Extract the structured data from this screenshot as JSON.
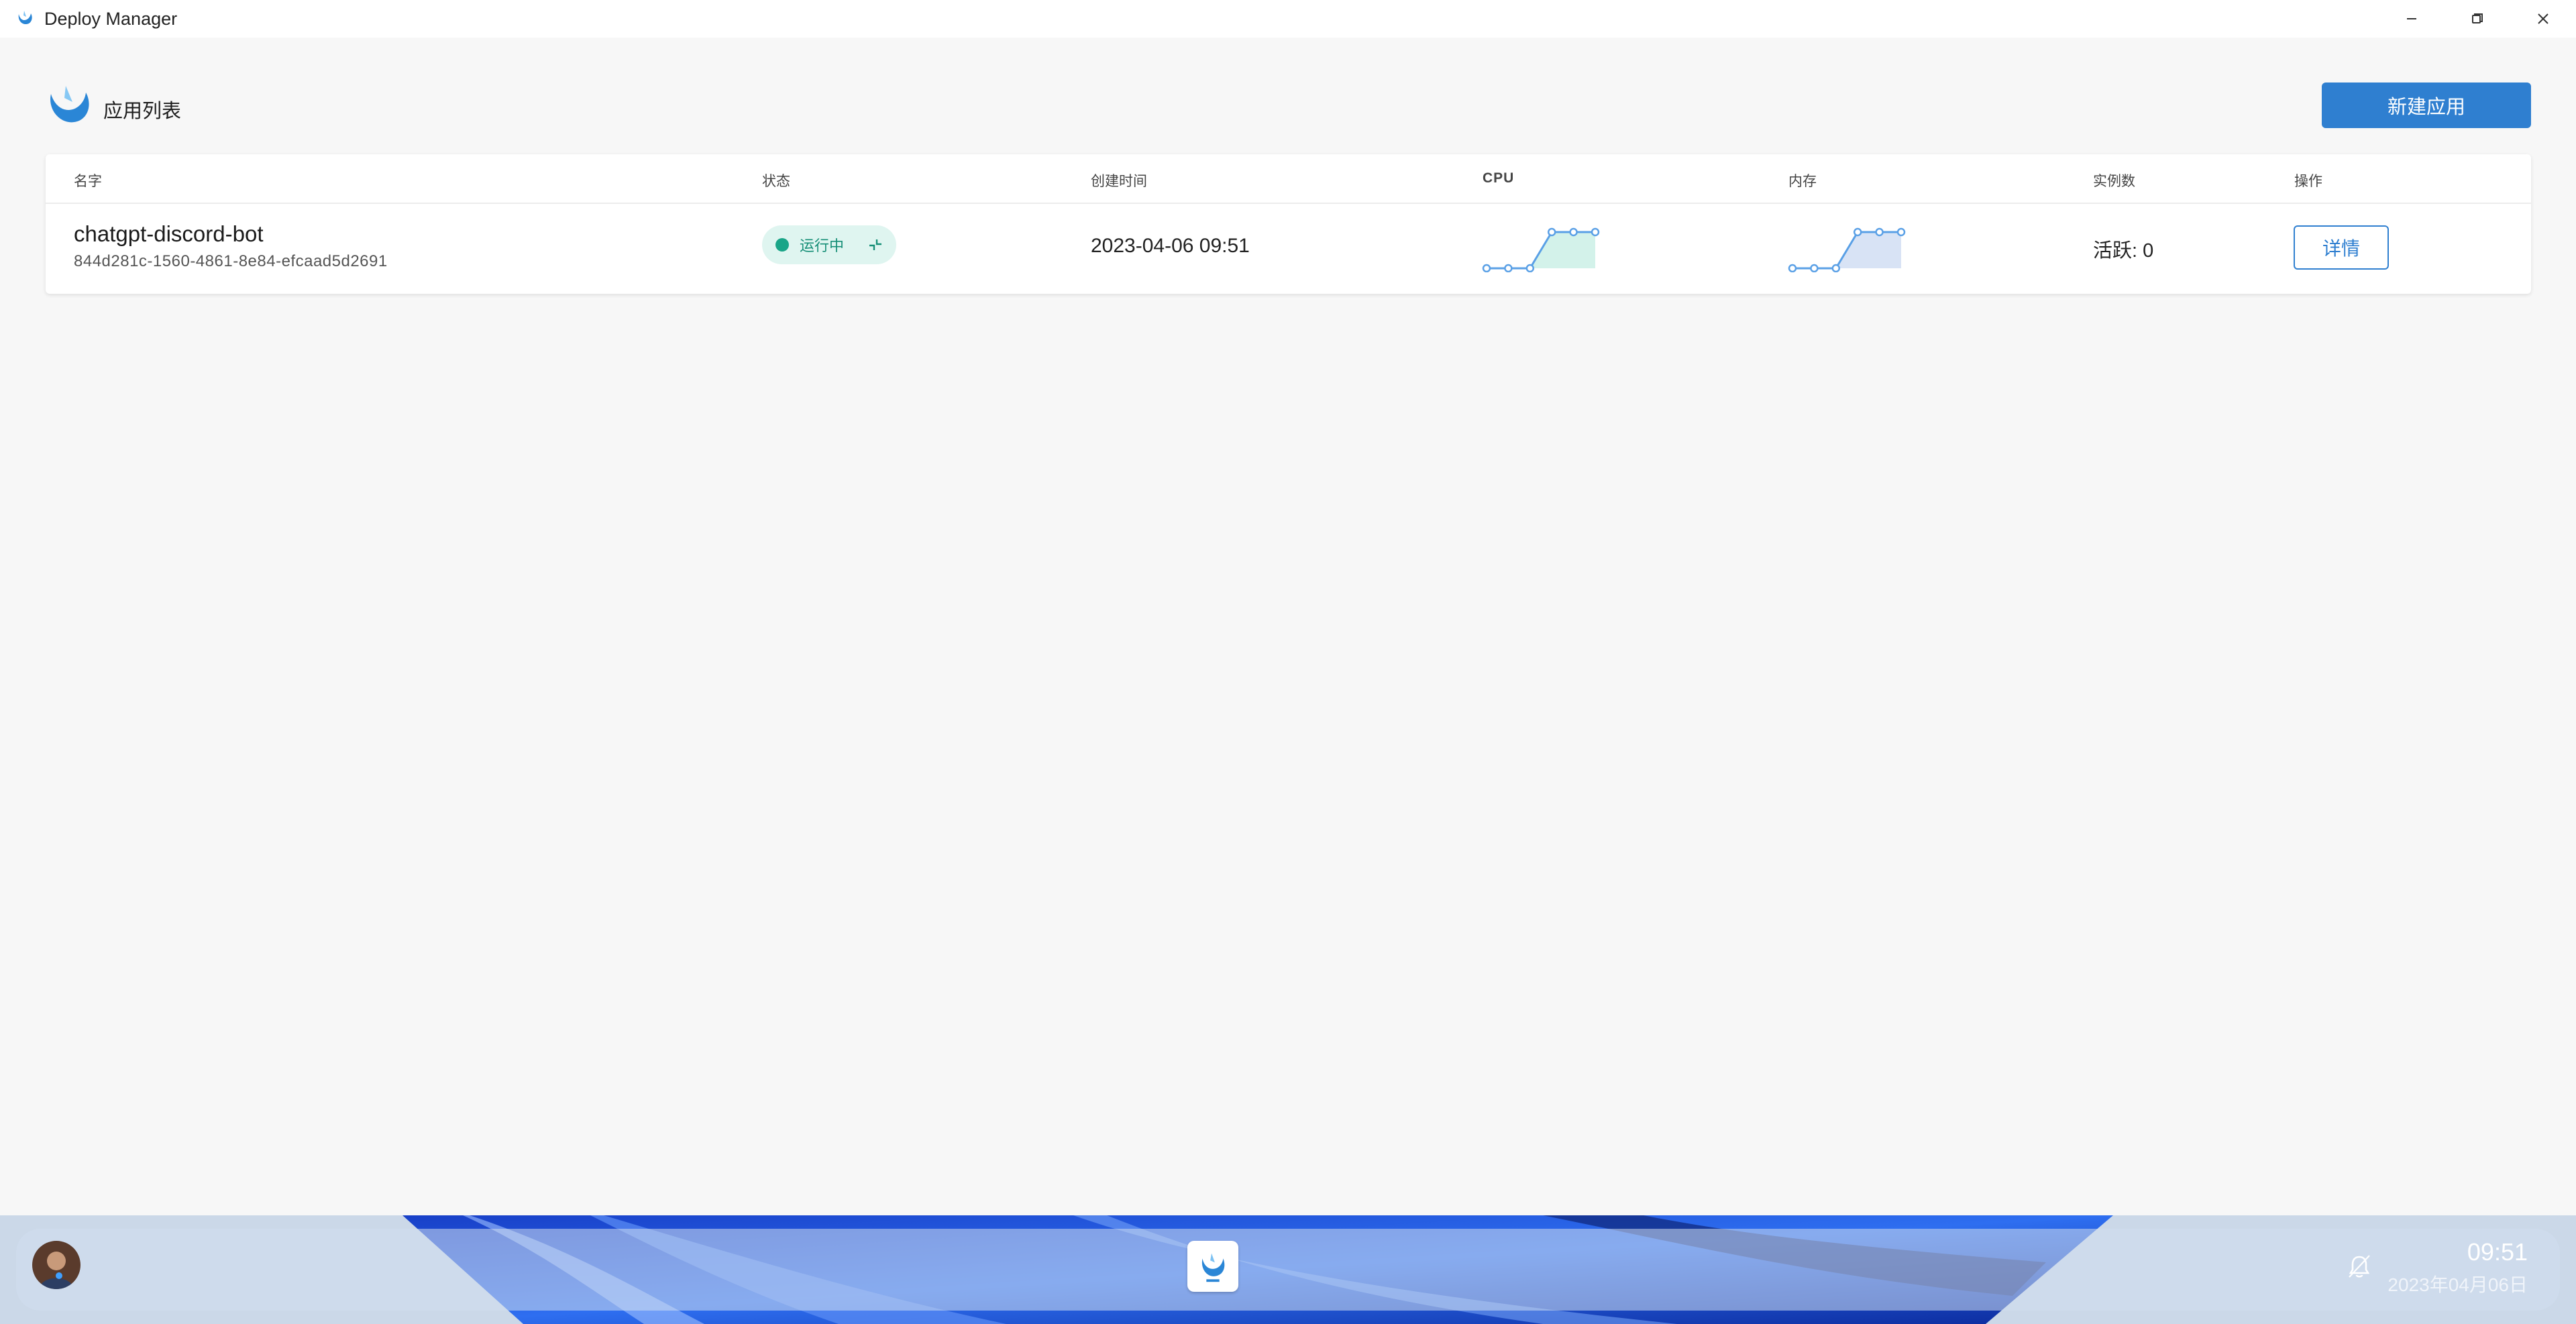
{
  "window": {
    "title": "Deploy Manager",
    "controls": [
      "minimize-icon",
      "restore-icon",
      "close-icon"
    ]
  },
  "header": {
    "title": "应用列表",
    "new_app_label": "新建应用"
  },
  "table": {
    "columns": [
      "名字",
      "状态",
      "创建时间",
      "CPU",
      "内存",
      "实例数",
      "操作"
    ],
    "rows": [
      {
        "name": "chatgpt-discord-bot",
        "id": "844d281c-1560-4861-8e84-efcaad5d2691",
        "status": "运行中",
        "created": "2023-04-06 09:51",
        "cpu_trend": [
          0,
          0,
          0,
          1,
          1,
          1
        ],
        "mem_trend": [
          0,
          0,
          0,
          1,
          1,
          1
        ],
        "instances": "活跃: 0",
        "action_label": "详情"
      }
    ]
  },
  "taskbar": {
    "time": "09:51",
    "date": "2023年04月06日"
  },
  "colors": {
    "accent": "#2f7fd0",
    "status_running": "#1aa588",
    "cpu_fill": "#d3f2ea",
    "mem_fill": "#d8e3f5",
    "spark_line": "#5aa0e6"
  }
}
